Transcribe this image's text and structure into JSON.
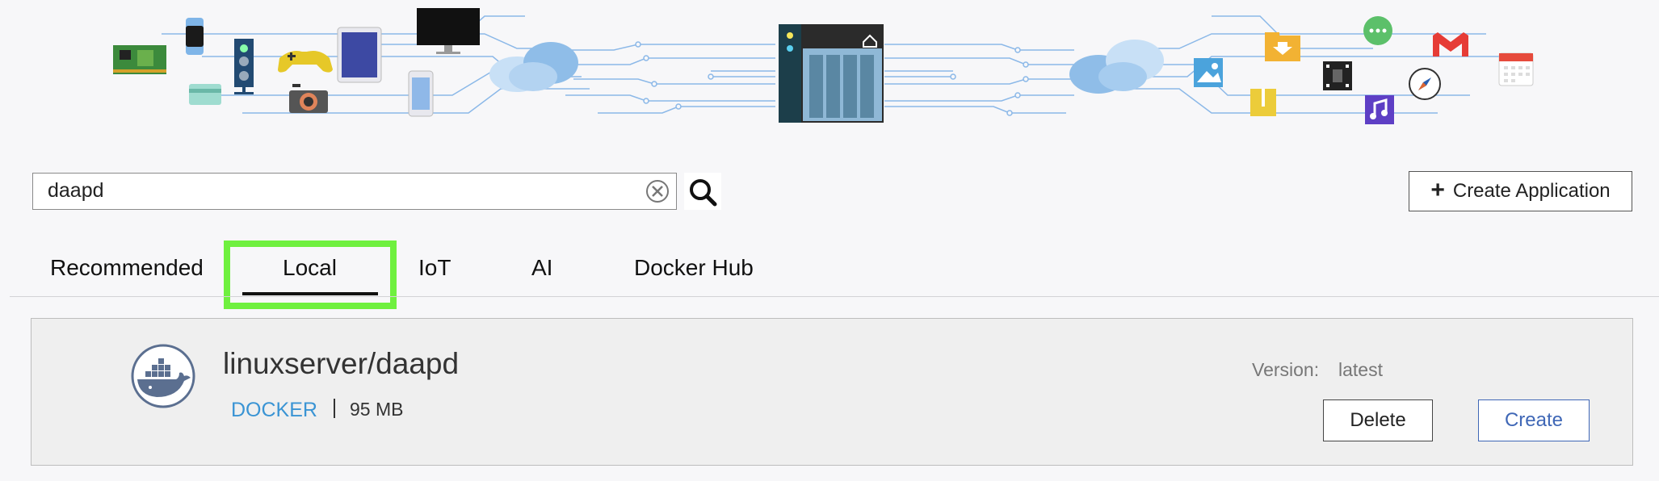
{
  "search": {
    "value": "daapd"
  },
  "header": {
    "create_application_label": "Create Application"
  },
  "tabs": [
    {
      "label": "Recommended"
    },
    {
      "label": "Local",
      "active": true
    },
    {
      "label": "IoT"
    },
    {
      "label": "AI"
    },
    {
      "label": "Docker Hub"
    }
  ],
  "app": {
    "name": "linuxserver/daapd",
    "type": "DOCKER",
    "size": "95 MB",
    "version_label": "Version:",
    "version_value": "latest",
    "delete_label": "Delete",
    "create_label": "Create"
  },
  "colors": {
    "tab_highlight": "#6ff03f",
    "type_link": "#3a94d4",
    "create_button": "#3f67b6"
  },
  "banner_icons": [
    "circuit-board-icon",
    "smartwatch-icon",
    "credit-card-icon",
    "speaker-icon",
    "gamepad-icon",
    "camera-icon",
    "tablet-icon",
    "monitor-icon",
    "phone-icon",
    "cloud-icon",
    "nas-server-icon",
    "photo-icon",
    "download-folder-icon",
    "zip-folder-icon",
    "film-icon",
    "chat-icon",
    "music-icon",
    "compass-icon",
    "mail-icon",
    "calendar-icon"
  ]
}
